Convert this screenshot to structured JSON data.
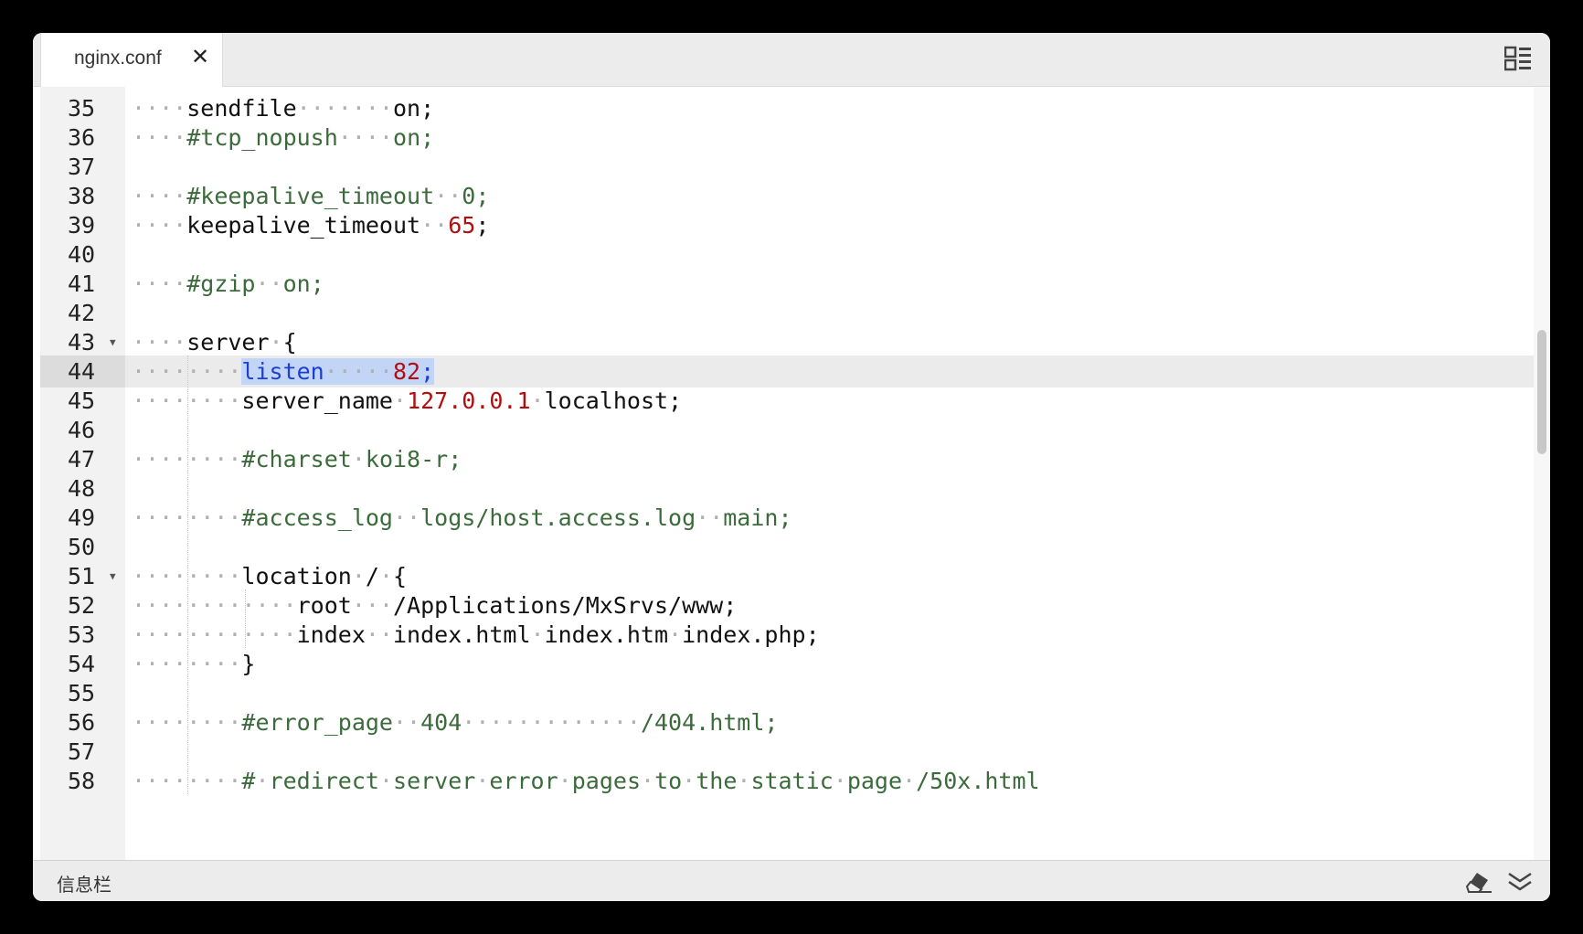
{
  "tab": {
    "title": "nginx.conf",
    "close_glyph": "✕"
  },
  "icons": {
    "layout": "layout-grid-icon",
    "close": "close-icon",
    "eraser": "eraser-icon",
    "collapse": "double-chevron-down-icon",
    "fold": "fold-arrow-icon"
  },
  "editor": {
    "highlighted_line": "44",
    "selection": "listen·····82;",
    "lines": [
      {
        "num": "35",
        "text": "····sendfile·······on;"
      },
      {
        "num": "36",
        "text": "····#tcp_nopush····on;"
      },
      {
        "num": "37",
        "text": ""
      },
      {
        "num": "38",
        "text": "····#keepalive_timeout··0;"
      },
      {
        "num": "39",
        "text": "····keepalive_timeout··65;"
      },
      {
        "num": "40",
        "text": ""
      },
      {
        "num": "41",
        "text": "····#gzip··on;"
      },
      {
        "num": "42",
        "text": ""
      },
      {
        "num": "43",
        "text": "····server·{"
      },
      {
        "num": "44",
        "text": "········listen·····82;"
      },
      {
        "num": "45",
        "text": "········server_name·127.0.0.1·localhost;"
      },
      {
        "num": "46",
        "text": ""
      },
      {
        "num": "47",
        "text": "········#charset·koi8-r;"
      },
      {
        "num": "48",
        "text": ""
      },
      {
        "num": "49",
        "text": "········#access_log··logs/host.access.log··main;"
      },
      {
        "num": "50",
        "text": ""
      },
      {
        "num": "51",
        "text": "········location·/·{"
      },
      {
        "num": "52",
        "text": "············root···/Applications/MxSrvs/www;"
      },
      {
        "num": "53",
        "text": "············index··index.html·index.htm·index.php;"
      },
      {
        "num": "54",
        "text": "········}"
      },
      {
        "num": "55",
        "text": ""
      },
      {
        "num": "56",
        "text": "········#error_page··404·············/404.html;"
      },
      {
        "num": "57",
        "text": ""
      },
      {
        "num": "58",
        "text": "········#·redirect·server·error·pages·to·the·static·page·/50x.html"
      }
    ]
  },
  "statusbar": {
    "label": "信息栏"
  }
}
